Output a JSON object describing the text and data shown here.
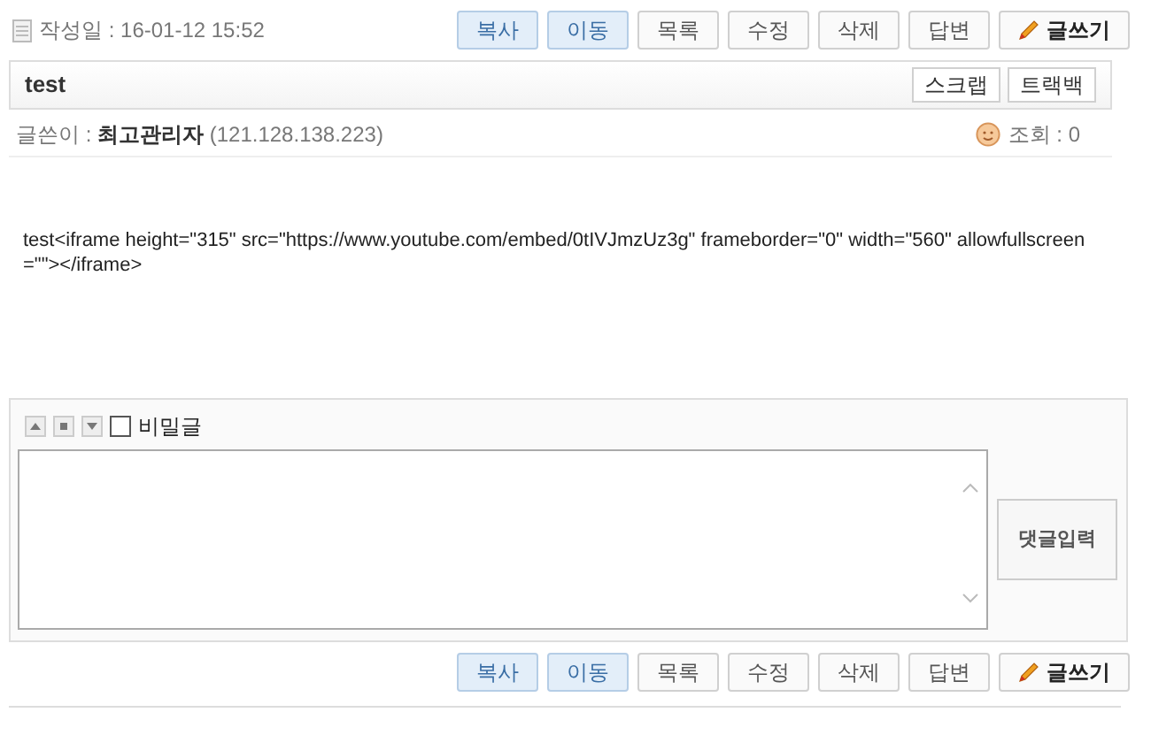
{
  "post_date": {
    "label": "작성일 :",
    "value": "16-01-12 15:52"
  },
  "top_buttons": [
    {
      "label": "복사",
      "kind": "admin"
    },
    {
      "label": "이동",
      "kind": "admin"
    },
    {
      "label": "목록",
      "kind": "plain"
    },
    {
      "label": "수정",
      "kind": "plain"
    },
    {
      "label": "삭제",
      "kind": "plain"
    },
    {
      "label": "답변",
      "kind": "plain"
    },
    {
      "label": "글쓰기",
      "kind": "write"
    }
  ],
  "title": "test",
  "title_buttons": [
    "스크랩",
    "트랙백"
  ],
  "author": {
    "label": "글쓴이 :",
    "name": "최고관리자",
    "ip": "(121.128.138.223)"
  },
  "views": {
    "label": "조회 :",
    "value": "0"
  },
  "content": "test<iframe height=\"315\" src=\"https://www.youtube.com/embed/0tIVJmzUz3g\" frameborder=\"0\" width=\"560\" allowfullscreen=\"\"></iframe>",
  "comment": {
    "secret_label": "비밀글",
    "secret_checked": false,
    "submit": "댓글입력"
  },
  "bottom_buttons": [
    {
      "label": "복사",
      "kind": "admin"
    },
    {
      "label": "이동",
      "kind": "admin"
    },
    {
      "label": "목록",
      "kind": "plain"
    },
    {
      "label": "수정",
      "kind": "plain"
    },
    {
      "label": "삭제",
      "kind": "plain"
    },
    {
      "label": "답변",
      "kind": "plain"
    },
    {
      "label": "글쓰기",
      "kind": "write"
    }
  ]
}
